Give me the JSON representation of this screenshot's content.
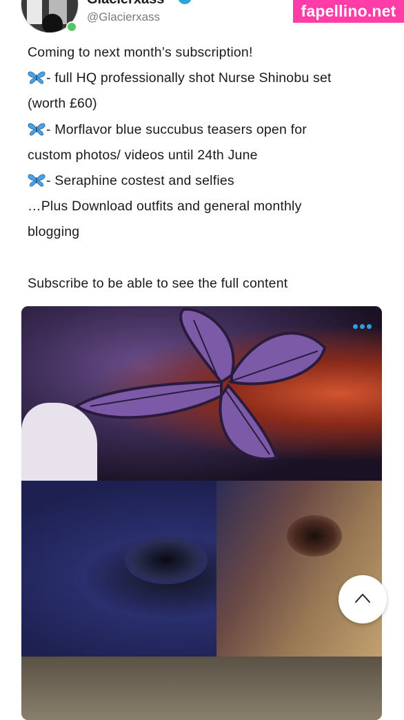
{
  "profile": {
    "display_name": "Glacierxass",
    "handle": "@Glacierxass",
    "online": true
  },
  "watermark": "fapellino.net",
  "post": {
    "lines": [
      {
        "icon": "",
        "text": "Coming to next month’s subscription!"
      },
      {
        "icon": "butterfly-icon",
        "text": "- full HQ professionally shot Nurse Shinobu set"
      },
      {
        "icon": "",
        "text": "(worth £60)"
      },
      {
        "icon": "butterfly-icon",
        "text": "- Morflavor blue succubus teasers open for"
      },
      {
        "icon": "",
        "text": "custom photos/ videos until 24th June"
      },
      {
        "icon": "butterfly-icon",
        "text": "- Seraphine costest and selfies"
      },
      {
        "icon": "",
        "text": "…Plus Download outfits and general monthly"
      },
      {
        "icon": "",
        "text": "blogging"
      },
      {
        "icon": "",
        "text": ""
      },
      {
        "icon": "",
        "text": "Subscribe to be able to see the full content"
      }
    ]
  },
  "media": {
    "more_icon": "more-dots-icon",
    "images": [
      "photo-butterfly-hairpin",
      "photo-eye-closeup",
      "photo-blonde-partial"
    ]
  },
  "scroll_top_icon": "chevron-up-icon",
  "colors": {
    "accent": "#2f9ee0",
    "online": "#53c767",
    "watermark_bg": "#ff3ca8",
    "text": "#1a1a1a",
    "muted": "#777b80"
  }
}
